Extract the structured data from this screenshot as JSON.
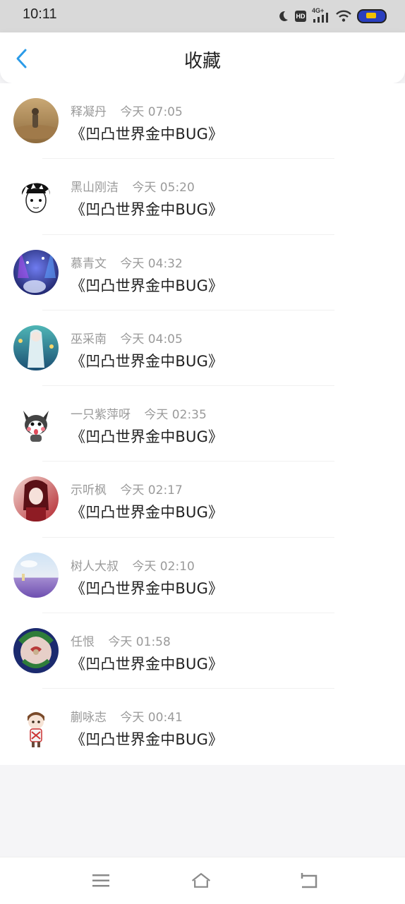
{
  "status_bar": {
    "time": "10:11",
    "icons": [
      "moon-icon",
      "hd-icon",
      "4g-signal-icon",
      "wifi-icon",
      "battery-icon"
    ],
    "hd_label": "HD",
    "network_label": "4G+"
  },
  "header": {
    "title": "收藏",
    "back_icon": "chevron-left-icon",
    "accent_color": "#2b9be8"
  },
  "items": [
    {
      "author": "释凝丹",
      "when": "今天  07:05",
      "title": "《凹凸世界金中BUG》",
      "avatar": "avatar-desert"
    },
    {
      "author": "黑山刚洁",
      "when": "今天  05:20",
      "title": "《凹凸世界金中BUG》",
      "avatar": "avatar-sketch-boy"
    },
    {
      "author": "慕青文",
      "when": "今天  04:32",
      "title": "《凹凸世界金中BUG》",
      "avatar": "avatar-blue-lights"
    },
    {
      "author": "巫采南",
      "when": "今天  04:05",
      "title": "《凹凸世界金中BUG》",
      "avatar": "avatar-anime-girl"
    },
    {
      "author": "一只紫萍呀",
      "when": "今天  02:35",
      "title": "《凹凸世界金中BUG》",
      "avatar": "avatar-husky"
    },
    {
      "author": "示听枫",
      "when": "今天  02:17",
      "title": "《凹凸世界金中BUG》",
      "avatar": "avatar-red-portrait"
    },
    {
      "author": "树人大叔",
      "when": "今天  02:10",
      "title": "《凹凸世界金中BUG》",
      "avatar": "avatar-lavender"
    },
    {
      "author": "任恨",
      "when": "今天  01:58",
      "title": "《凹凸世界金中BUG》",
      "avatar": "avatar-dragon"
    },
    {
      "author": "蒯咏志",
      "when": "今天  00:41",
      "title": "《凹凸世界金中BUG》",
      "avatar": "avatar-chibi"
    }
  ],
  "nav_bar": {
    "icons": [
      "menu-icon",
      "home-icon",
      "back-icon"
    ]
  }
}
